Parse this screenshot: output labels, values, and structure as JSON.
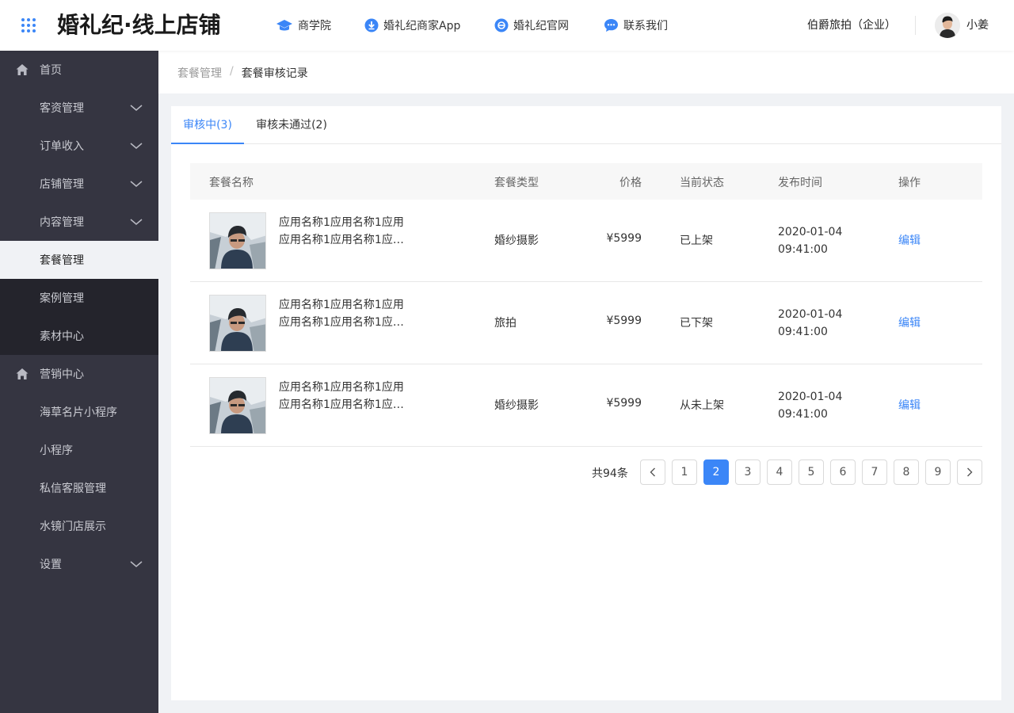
{
  "header": {
    "logo": "婚礼纪·线上店铺",
    "nav": [
      {
        "label": "商学院",
        "icon": "graduation-cap-icon"
      },
      {
        "label": "婚礼纪商家App",
        "icon": "download-icon"
      },
      {
        "label": "婚礼纪官网",
        "icon": "browser-icon"
      },
      {
        "label": "联系我们",
        "icon": "chat-bubble-icon"
      }
    ],
    "company": "伯爵旅拍（企业）",
    "username": "小姜"
  },
  "sidebar": {
    "items": [
      {
        "label": "首页",
        "icon": "home-icon"
      },
      {
        "label": "客资管理",
        "expandable": true
      },
      {
        "label": "订单收入",
        "expandable": true
      },
      {
        "label": "店铺管理",
        "expandable": true
      },
      {
        "label": "内容管理",
        "expandable": true
      },
      {
        "label": "套餐管理",
        "active": true
      },
      {
        "label": "案例管理"
      },
      {
        "label": "素材中心"
      },
      {
        "label": "营销中心",
        "icon": "home-icon"
      },
      {
        "label": "海草名片小程序"
      },
      {
        "label": "小程序"
      },
      {
        "label": "私信客服管理"
      },
      {
        "label": "水镜门店展示"
      },
      {
        "label": "设置",
        "expandable": true
      }
    ]
  },
  "breadcrumb": {
    "parent": "套餐管理",
    "separator": "/",
    "current": "套餐审核记录"
  },
  "tabs": [
    {
      "label": "审核中(3)",
      "active": true
    },
    {
      "label": "审核未通过(2)",
      "active": false
    }
  ],
  "table": {
    "headers": {
      "name": "套餐名称",
      "type": "套餐类型",
      "price": "价格",
      "status": "当前状态",
      "time": "发布时间",
      "action": "操作"
    },
    "rows": [
      {
        "name_line1": "应用名称1应用名称1应用",
        "name_line2": "应用名称1应用名称1应…",
        "type": "婚纱摄影",
        "price": "¥5999",
        "status": "已上架",
        "date": "2020-01-04",
        "time": "09:41:00",
        "action": "编辑"
      },
      {
        "name_line1": "应用名称1应用名称1应用",
        "name_line2": "应用名称1应用名称1应…",
        "type": "旅拍",
        "price": "¥5999",
        "status": "已下架",
        "date": "2020-01-04",
        "time": "09:41:00",
        "action": "编辑"
      },
      {
        "name_line1": "应用名称1应用名称1应用",
        "name_line2": "应用名称1应用名称1应…",
        "type": "婚纱摄影",
        "price": "¥5999",
        "status": "从未上架",
        "date": "2020-01-04",
        "time": "09:41:00",
        "action": "编辑"
      }
    ]
  },
  "pagination": {
    "total": "共94条",
    "pages": [
      "1",
      "2",
      "3",
      "4",
      "5",
      "6",
      "7",
      "8",
      "9"
    ],
    "current": "2"
  },
  "colors": {
    "accent": "#3b86f7",
    "sidebar_bg": "#353541",
    "sidebar_sub_bg": "#24242c",
    "page_bg": "#f0f2f5"
  }
}
